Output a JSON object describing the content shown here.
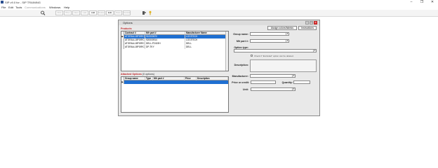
{
  "window": {
    "title": "SIP v9.0 for - SIP TRAINING",
    "controls": [
      "–",
      "❐",
      "✕"
    ]
  },
  "menu": [
    {
      "label": "File",
      "enabled": true
    },
    {
      "label": "Edit",
      "enabled": true
    },
    {
      "label": "Tools",
      "enabled": true
    },
    {
      "label": "Communications",
      "enabled": false
    },
    {
      "label": "Windows",
      "enabled": true
    },
    {
      "label": "Help",
      "enabled": true
    }
  ],
  "toolbar": {
    "buttons": [
      {
        "label": "First",
        "active": false
      },
      {
        "label": "Prev",
        "active": false
      },
      {
        "label": "Next",
        "active": false
      },
      {
        "label": "Last",
        "active": false
      },
      {
        "label": "Add",
        "active": true
      },
      {
        "label": "Delete",
        "active": false
      },
      {
        "label": "Edit",
        "active": true
      },
      {
        "label": "Save",
        "active": false
      },
      {
        "label": "Cancel",
        "active": false
      }
    ]
  },
  "dialog": {
    "title": "Options",
    "buttons": {
      "assign": "Assign colors/fabrics",
      "instructions": "Instructions"
    },
    "products": {
      "label": "Products",
      "columns": [
        "Contract #",
        "Mfr part #",
        "Manufacturer Name"
      ],
      "rows": [
        {
          "contract": "ATGRAA-18P19RC",
          "mfr_part": "910000670",
          "manufacturer": "LOGITECH",
          "selected": true
        },
        {
          "contract": "ATGRAA-18P19RC",
          "mfr_part": "920000914",
          "manufacturer": "LOGITECH",
          "selected": false
        },
        {
          "contract": "ATGRAA-18P19RC",
          "mfr_part": "DELL-P2419H",
          "manufacturer": "DELL",
          "selected": false
        },
        {
          "contract": "ATGRAA-18P19RC",
          "mfr_part": "DP-TKY",
          "manufacturer": "DELL",
          "selected": false
        }
      ]
    },
    "attached": {
      "label": "Attached Options",
      "count": "(0 options)",
      "columns": [
        "Group name",
        "Type",
        "Mfr part #",
        "Price",
        "Description"
      ]
    },
    "form": {
      "group_name": "Group name:",
      "mfr_part": "Mfr part #:",
      "option_type": "Option type:",
      "excluded_note": "Check if \"Excluded\" option can be deleted.",
      "description": "Description:",
      "manufacturer": "Manufacturer:",
      "price": "Price or credit:",
      "quantity": "Quantity:",
      "unit": "Unit:"
    }
  }
}
